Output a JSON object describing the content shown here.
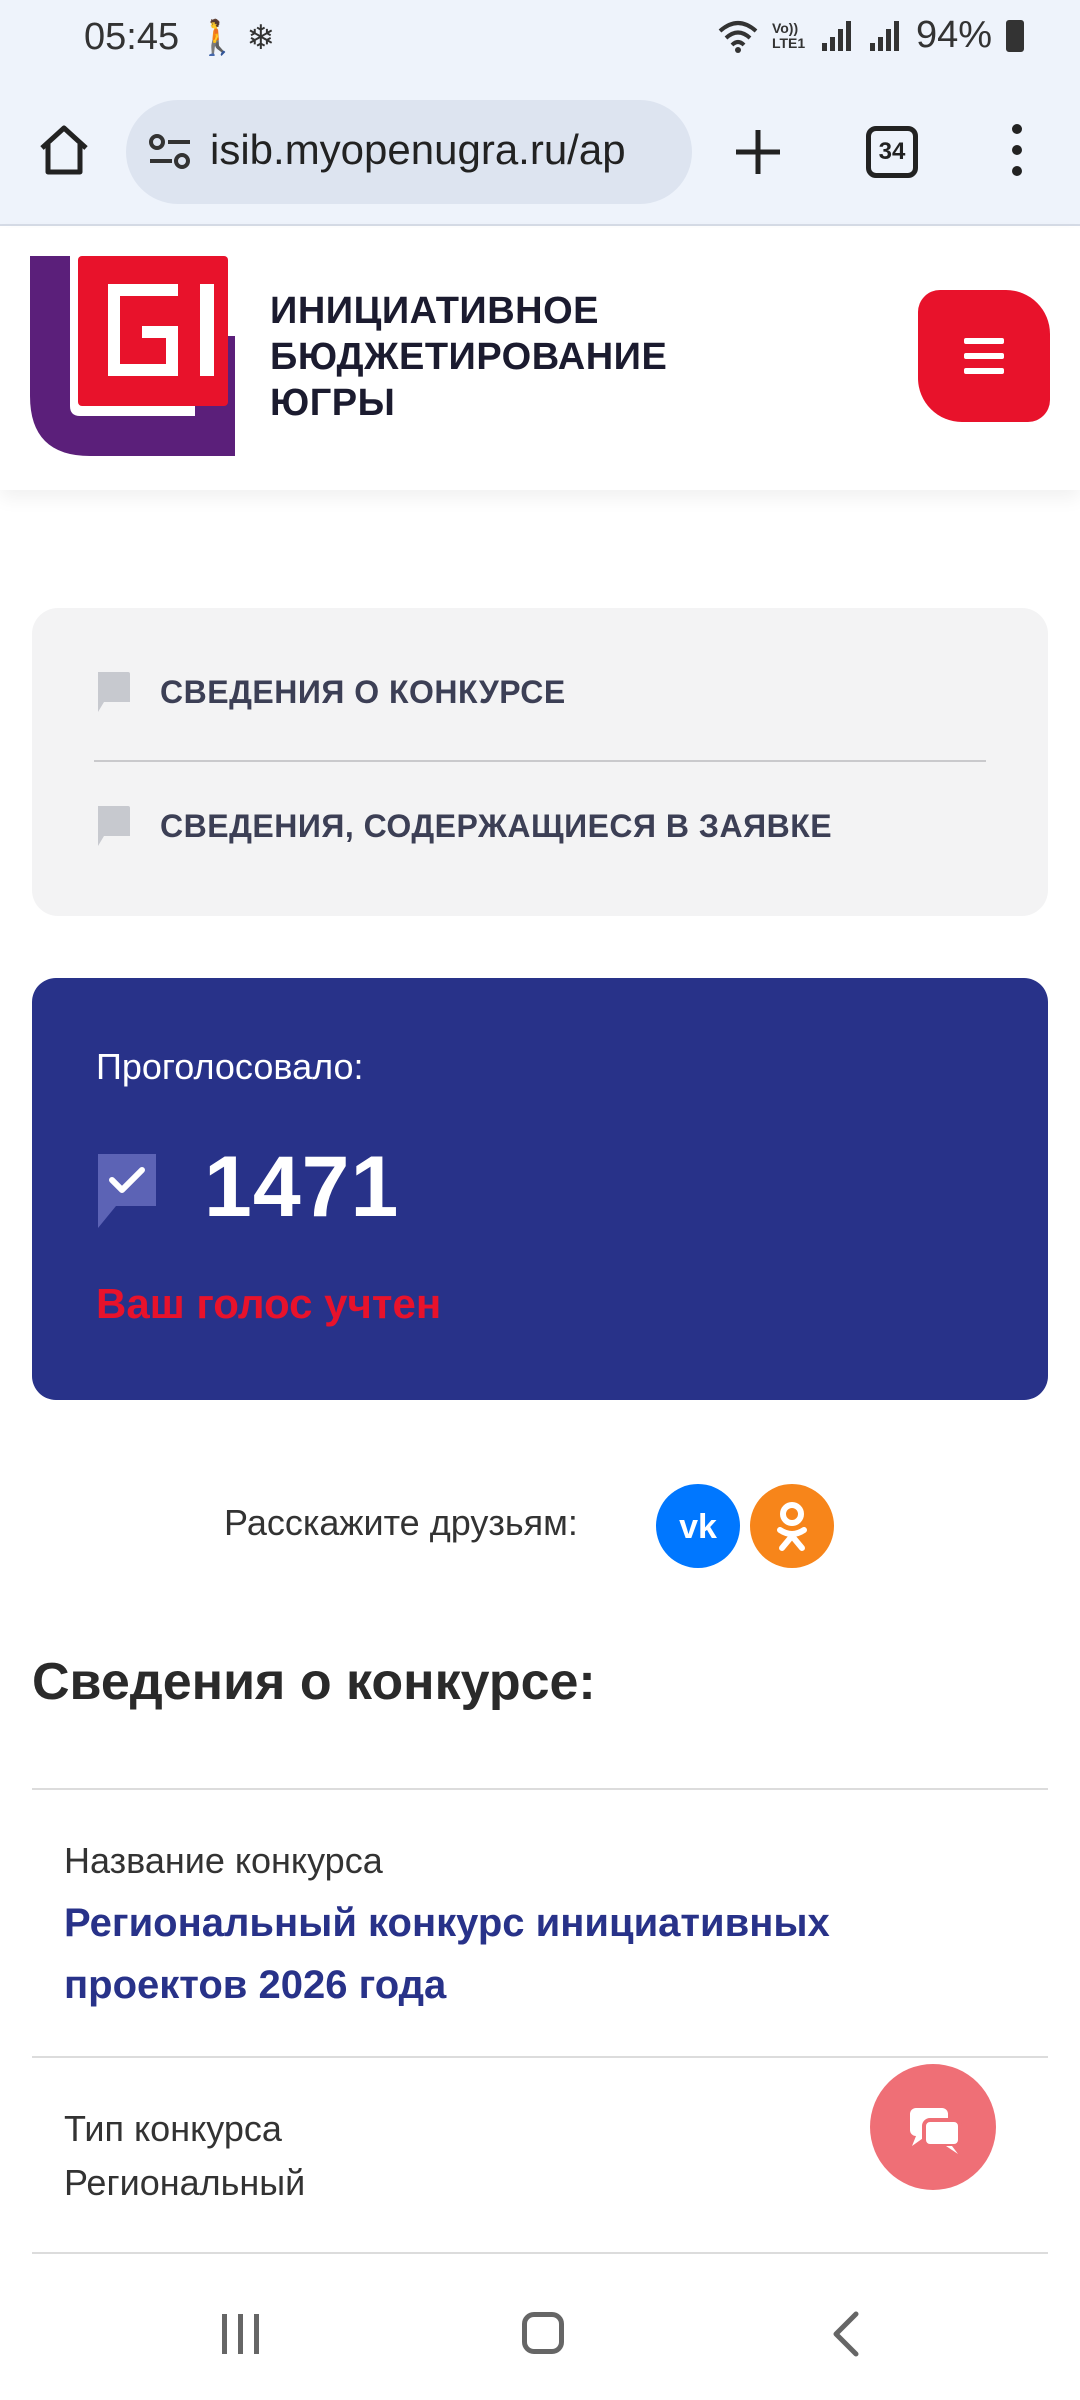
{
  "status_bar": {
    "time": "05:45",
    "left_icons": [
      "walking-icon",
      "snowflake-icon"
    ],
    "right_icons": [
      "wifi-icon",
      "volte-icon",
      "signal-icon",
      "signal-icon"
    ],
    "volte_label": "Vo)) LTE1",
    "battery": "94%"
  },
  "browser": {
    "url": "isib.myopenugra.ru/ap",
    "tab_count": "34"
  },
  "site": {
    "title_line1": "ИНИЦИАТИВНОЕ",
    "title_line2": "БЮДЖЕТИРОВАНИЕ",
    "title_line3": "ЮГРЫ",
    "brand_red": "#e8122b",
    "brand_blue": "#283289"
  },
  "info_links": [
    {
      "label": "СВЕДЕНИЯ О КОНКУРСЕ"
    },
    {
      "label": "СВЕДЕНИЯ, СОДЕРЖАЩИЕСЯ В ЗАЯВКЕ"
    }
  ],
  "vote": {
    "label": "Проголосовало:",
    "count": "1471",
    "status": "Ваш голос учтен"
  },
  "share": {
    "label": "Расскажите друзьям:",
    "networks": [
      "vk-icon",
      "odnoklassniki-icon"
    ]
  },
  "contest": {
    "section_title": "Сведения о конкурсе:",
    "name_label": "Название конкурса",
    "name_value": "Региональный конкурс инициативных проектов 2026 года",
    "type_label": "Тип конкурса",
    "type_value": "Региональный"
  }
}
